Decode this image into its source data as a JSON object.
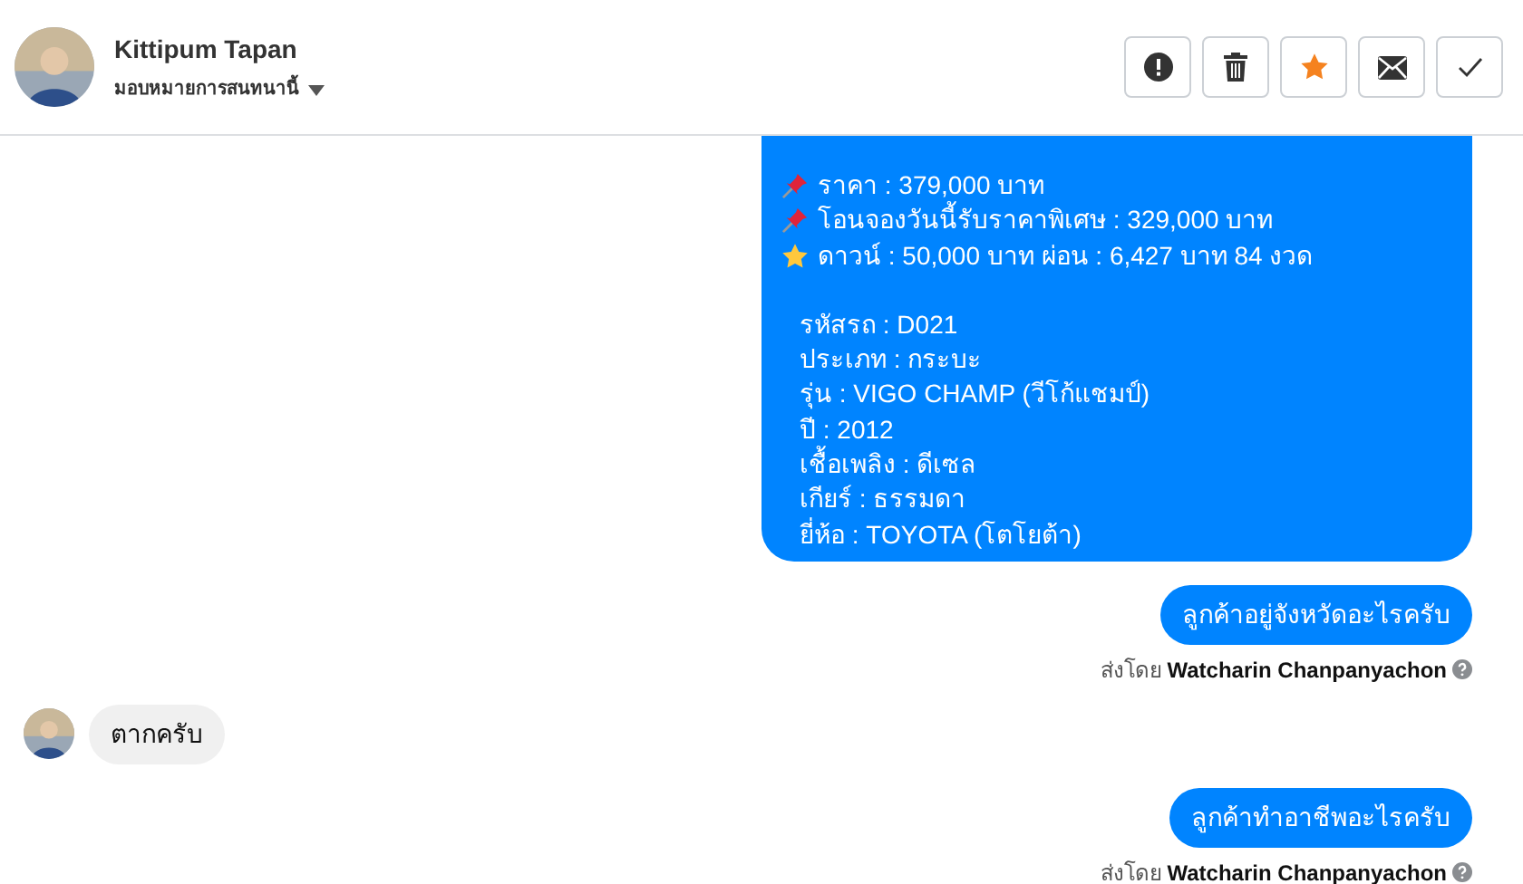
{
  "header": {
    "name": "Kittipum Tapan",
    "assign_label": "มอบหมายการสนทนานี้",
    "starred": true,
    "actions": [
      {
        "kind": "alert"
      },
      {
        "kind": "trash"
      },
      {
        "kind": "star"
      },
      {
        "kind": "mail"
      },
      {
        "kind": "check"
      }
    ]
  },
  "messages": [
    {
      "kind": "card",
      "lines": [
        {
          "kind": "pin",
          "text": "ราคา : 379,000 บาท"
        },
        {
          "kind": "pin",
          "text": "โอนจองวันนี้รับราคาพิเศษ : 329,000 บาท"
        },
        {
          "kind": "star",
          "text": "ดาวน์ : 50,000 บาท ผ่อน : 6,427 บาท 84 งวด"
        },
        {
          "kind": "detail",
          "text": "รหัสรถ : D021"
        },
        {
          "kind": "detail",
          "text": "ประเภท : กระบะ"
        },
        {
          "kind": "detail",
          "text": "รุ่น : VIGO CHAMP (วีโก้แชมป์)"
        },
        {
          "kind": "detail",
          "text": "ปี : 2012"
        },
        {
          "kind": "detail",
          "text": "เชื้อเพลิง : ดีเซล"
        },
        {
          "kind": "detail",
          "text": "เกียร์ : ธรรมดา"
        },
        {
          "kind": "detail",
          "text": "ยี่ห้อ : TOYOTA (โตโยต้า)"
        }
      ]
    },
    {
      "kind": "outgoing",
      "text": "ลูกค้าอยู่จังหวัดอะไรครับ",
      "sent_by_label": "ส่งโดย",
      "sent_by_name": "Watcharin Chanpanyachon"
    },
    {
      "kind": "incoming",
      "text": "ตากครับ"
    },
    {
      "kind": "outgoing",
      "text": "ลูกค้าทำอาชีพอะไรครับ",
      "sent_by_label": "ส่งโดย",
      "sent_by_name": "Watcharin Chanpanyachon"
    }
  ]
}
